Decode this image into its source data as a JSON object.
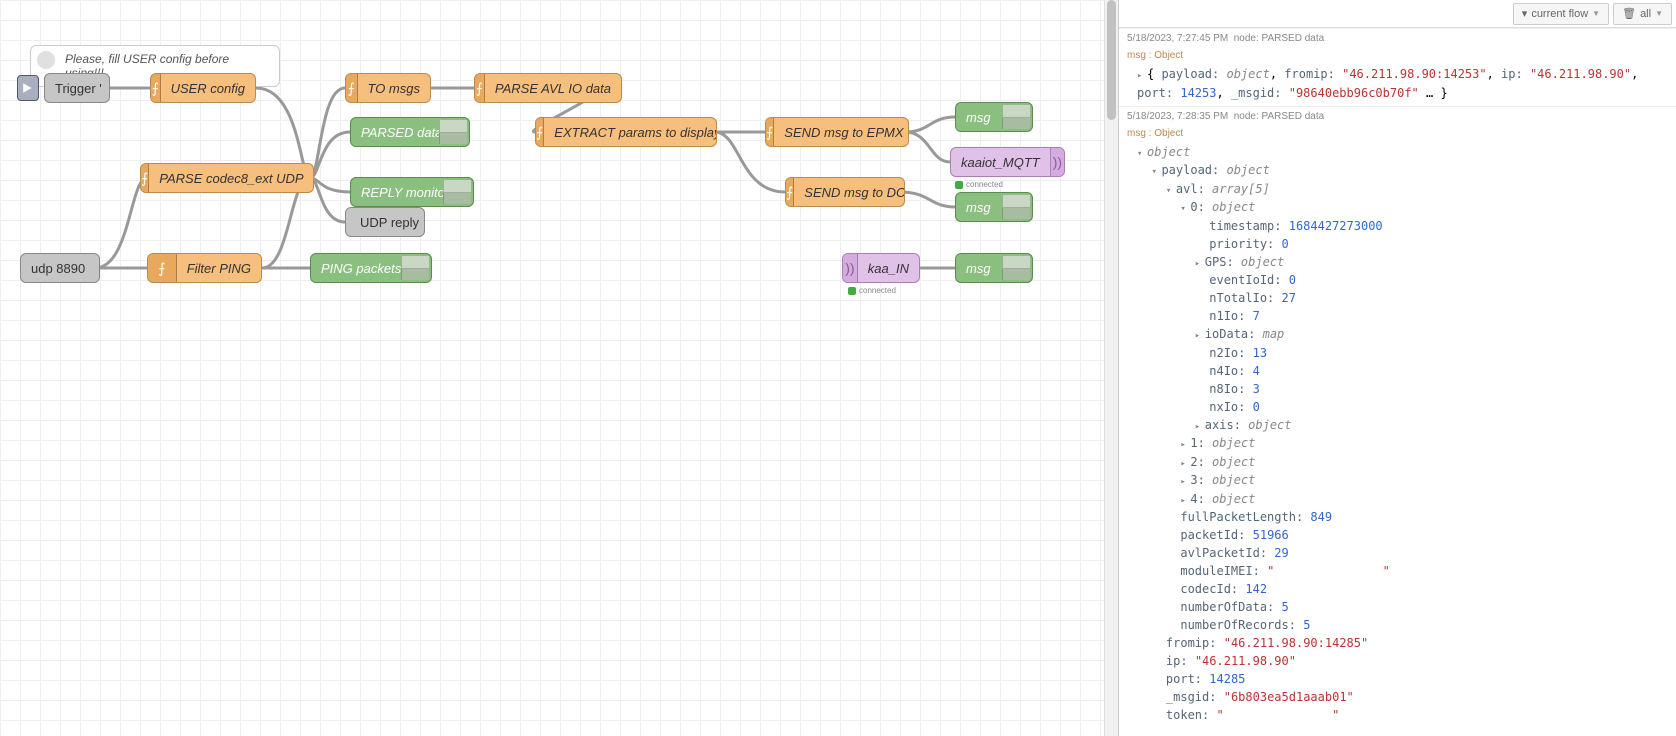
{
  "toolbar": {
    "filter": "current flow",
    "clear": "all"
  },
  "comment": "Please, fill USER config before using!!!",
  "nodes": {
    "trigger": "Trigger '",
    "userconfig": "USER config",
    "tomsgs": "TO msgs",
    "parseavl": "PARSE AVL IO data",
    "parseddata": "PARSED data",
    "replymon": "REPLY monitor",
    "parsecodec": "PARSE codec8_ext UDP",
    "udpreply": "UDP reply",
    "udp8890": "udp 8890",
    "filterping": "Filter PING",
    "pingpackets": "PING packets",
    "extract": "EXTRACT params to display",
    "sendepmx": "SEND msg to EPMX",
    "senddcx": "SEND msg to DCX",
    "kaaiotmqtt": "kaaiot_MQTT",
    "kaain": "kaa_IN",
    "msg1": "msg",
    "msg2": "msg",
    "msg3": "msg"
  },
  "status": {
    "connected": "connected"
  },
  "debug": {
    "entry1": {
      "ts": "5/18/2023, 7:27:45 PM",
      "src": "node: PARSED data",
      "sub": "msg : Object",
      "line": "{ payload: object, fromip: \"46.211.98.90:14253\", ip: \"46.211.98.90\", port: 14253, _msgid: \"98640ebb96c0b70f\" … }"
    },
    "entry2": {
      "ts": "5/18/2023, 7:28:35 PM",
      "src": "node: PARSED data",
      "sub": "msg : Object",
      "tree": {
        "root": "object",
        "payload": "payload: object",
        "avl": "avl: array[5]",
        "idx0": "0: object",
        "timestamp_k": "timestamp:",
        "timestamp_v": "1684427273000",
        "priority_k": "priority:",
        "priority_v": "0",
        "gps": "GPS: object",
        "eventIoId_k": "eventIoId:",
        "eventIoId_v": "0",
        "nTotalIo_k": "nTotalIo:",
        "nTotalIo_v": "27",
        "n1Io_k": "n1Io:",
        "n1Io_v": "7",
        "ioData": "ioData: map",
        "n2Io_k": "n2Io:",
        "n2Io_v": "13",
        "n4Io_k": "n4Io:",
        "n4Io_v": "4",
        "n8Io_k": "n8Io:",
        "n8Io_v": "3",
        "nxIo_k": "nxIo:",
        "nxIo_v": "0",
        "axis": "axis: object",
        "idx1": "1: object",
        "idx2": "2: object",
        "idx3": "3: object",
        "idx4": "4: object",
        "fpl_k": "fullPacketLength:",
        "fpl_v": "849",
        "pid_k": "packetId:",
        "pid_v": "51966",
        "apid_k": "avlPacketId:",
        "apid_v": "29",
        "imei_k": "moduleIMEI:",
        "imei_v": "\"               \"",
        "codec_k": "codecId:",
        "codec_v": "142",
        "nod_k": "numberOfData:",
        "nod_v": "5",
        "nor_k": "numberOfRecords:",
        "nor_v": "5",
        "fromip_k": "fromip:",
        "fromip_v": "\"46.211.98.90:14285\"",
        "ip_k": "ip:",
        "ip_v": "\"46.211.98.90\"",
        "port_k": "port:",
        "port_v": "14285",
        "msgid_k": "_msgid:",
        "msgid_v": "\"6b803ea5d1aaab01\"",
        "token_k": "token:",
        "token_v": "\"               \""
      }
    }
  }
}
